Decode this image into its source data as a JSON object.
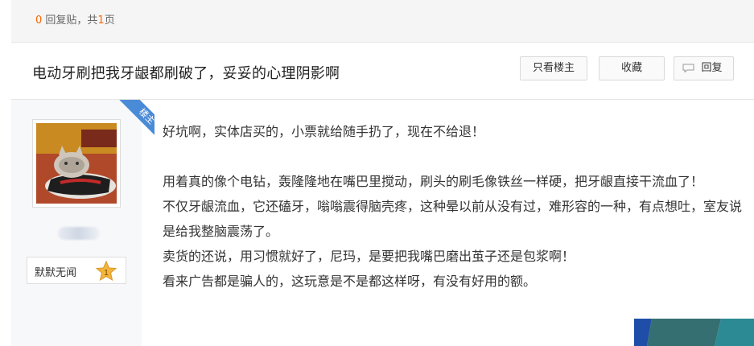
{
  "reply_info": {
    "count": "0",
    "label_after_count": " 回复贴，共",
    "pages": "1",
    "label_after_pages": "页"
  },
  "thread": {
    "title": "电动牙刷把我牙龈都刷破了，妥妥的心理阴影啊"
  },
  "toolbar": {
    "only_op_label": "只看楼主",
    "favorite_label": "收藏",
    "reply_label": "回复",
    "reply_icon": "comment-bubble-icon"
  },
  "author": {
    "badge_label": "楼主",
    "avatar_icon": "cat-on-sneaker-avatar",
    "level_name": "默默无闻",
    "level_number": "1"
  },
  "post": {
    "lines": [
      "好坑啊，实体店买的，小票就给随手扔了，现在不给退！",
      "",
      "用着真的像个电钻，轰隆隆地在嘴巴里搅动，刷头的刷毛像铁丝一样硬，把牙龈直接干流血了！",
      "不仅牙龈流血，它还磕牙，嗡嗡震得脑壳疼，这种晕以前从没有过，难形容的一种，有点想吐，室友说是给我整脑震荡了。",
      "卖货的还说，用习惯就好了，尼玛，是要把我嘴巴磨出茧子还是包浆啊！",
      "看来广告都是骗人的，这玩意是不是都这样呀，有没有好用的额。"
    ]
  },
  "colors": {
    "accent_orange": "#ff6600",
    "badge_blue": "#4a8bd8",
    "star_gold": "#f2b53a"
  }
}
